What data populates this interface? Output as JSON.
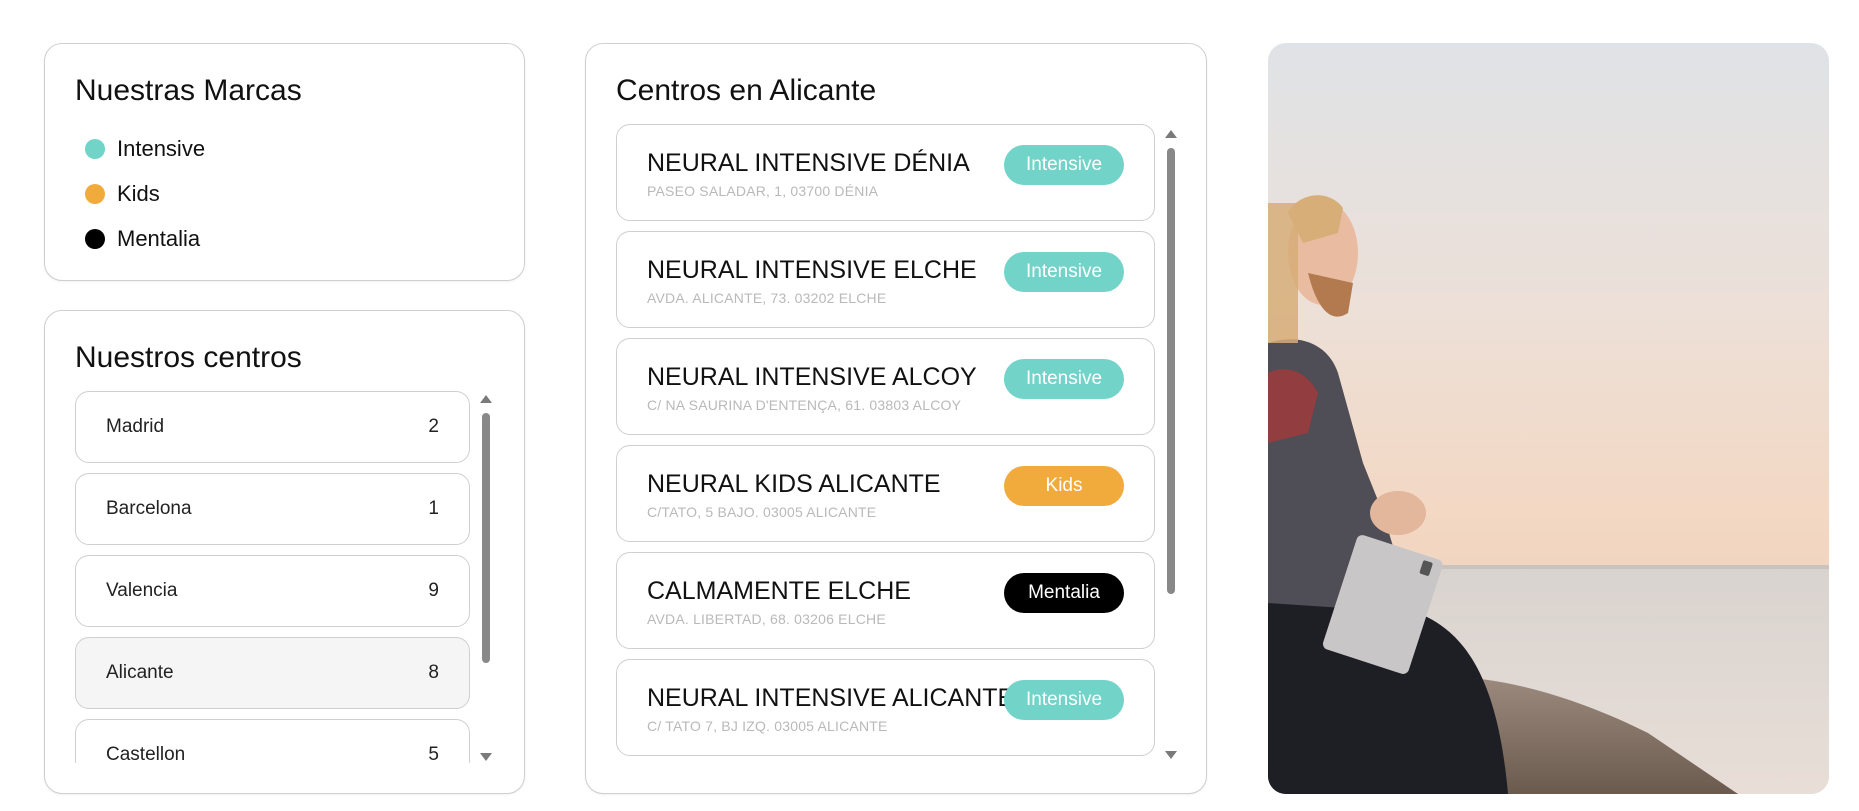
{
  "brands": {
    "title": "Nuestras Marcas",
    "items": [
      {
        "label": "Intensive",
        "color": "#72d3c9"
      },
      {
        "label": "Kids",
        "color": "#f0ab3c"
      },
      {
        "label": "Mentalia",
        "color": "#000000"
      }
    ]
  },
  "centros": {
    "title": "Nuestros centros",
    "cities": [
      {
        "name": "Madrid",
        "count": "2"
      },
      {
        "name": "Barcelona",
        "count": "1"
      },
      {
        "name": "Valencia",
        "count": "9"
      },
      {
        "name": "Alicante",
        "count": "8",
        "selected": true
      },
      {
        "name": "Castellon",
        "count": "5"
      }
    ]
  },
  "alicante": {
    "title": "Centros en Alicante",
    "centers": [
      {
        "name": "NEURAL INTENSIVE DÉNIA",
        "address": "PASEO SALADAR, 1, 03700 DÉNIA",
        "brand": "Intensive",
        "color": "#72d3c9"
      },
      {
        "name": "NEURAL INTENSIVE ELCHE",
        "address": "AVDA. ALICANTE, 73. 03202 ELCHE",
        "brand": "Intensive",
        "color": "#72d3c9"
      },
      {
        "name": "NEURAL INTENSIVE ALCOY",
        "address": "C/ NA SAURINA D'ENTENÇA, 61. 03803 ALCOY",
        "brand": "Intensive",
        "color": "#72d3c9"
      },
      {
        "name": "NEURAL KIDS ALICANTE",
        "address": "C/TATO, 5 BAJO. 03005 ALICANTE",
        "brand": "Kids",
        "color": "#f0ab3c"
      },
      {
        "name": "CALMAMENTE ELCHE",
        "address": "AVDA. LIBERTAD, 68. 03206 ELCHE",
        "brand": "Mentalia",
        "color": "#000000"
      },
      {
        "name": "NEURAL INTENSIVE ALICANTE",
        "address": "C/ TATO 7, BJ IZQ. 03005 ALICANTE",
        "brand": "Intensive",
        "color": "#72d3c9"
      }
    ]
  }
}
